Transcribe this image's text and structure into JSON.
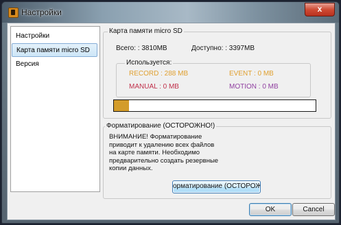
{
  "window": {
    "title": "Настройки",
    "close_glyph": "x"
  },
  "sidebar": {
    "items": [
      {
        "label": "Настройки",
        "selected": false
      },
      {
        "label": "Карта памяти micro SD",
        "selected": true
      },
      {
        "label": "Версия",
        "selected": false
      }
    ]
  },
  "sd": {
    "legend": "Карта памяти micro SD",
    "total": "Всего: : 3810MB",
    "available": "Доступно: : 3397MB",
    "used": {
      "legend": "Используется:",
      "record": "RECORD : 288 MB",
      "event": "EVENT : 0 MB",
      "manual": "MANUAL : 0 MB",
      "motion": "MOTION : 0 MB"
    },
    "usage_fraction": 0.076,
    "colors": {
      "record": "#e0a030",
      "event": "#e0a030",
      "manual": "#c0304a",
      "motion": "#9040a0",
      "bar": "#d39c2a"
    }
  },
  "format": {
    "legend": "Форматирование (ОСТОРОЖНО!)",
    "warning": "ВНИМАНИЕ! Форматирование приводит к удалению всех файлов на карте памяти. Необходимо предварительно создать резервные копии данных.",
    "button_label": "орматирование (ОСТОРОЖНС"
  },
  "footer": {
    "ok": "OK",
    "cancel": "Cancel"
  }
}
